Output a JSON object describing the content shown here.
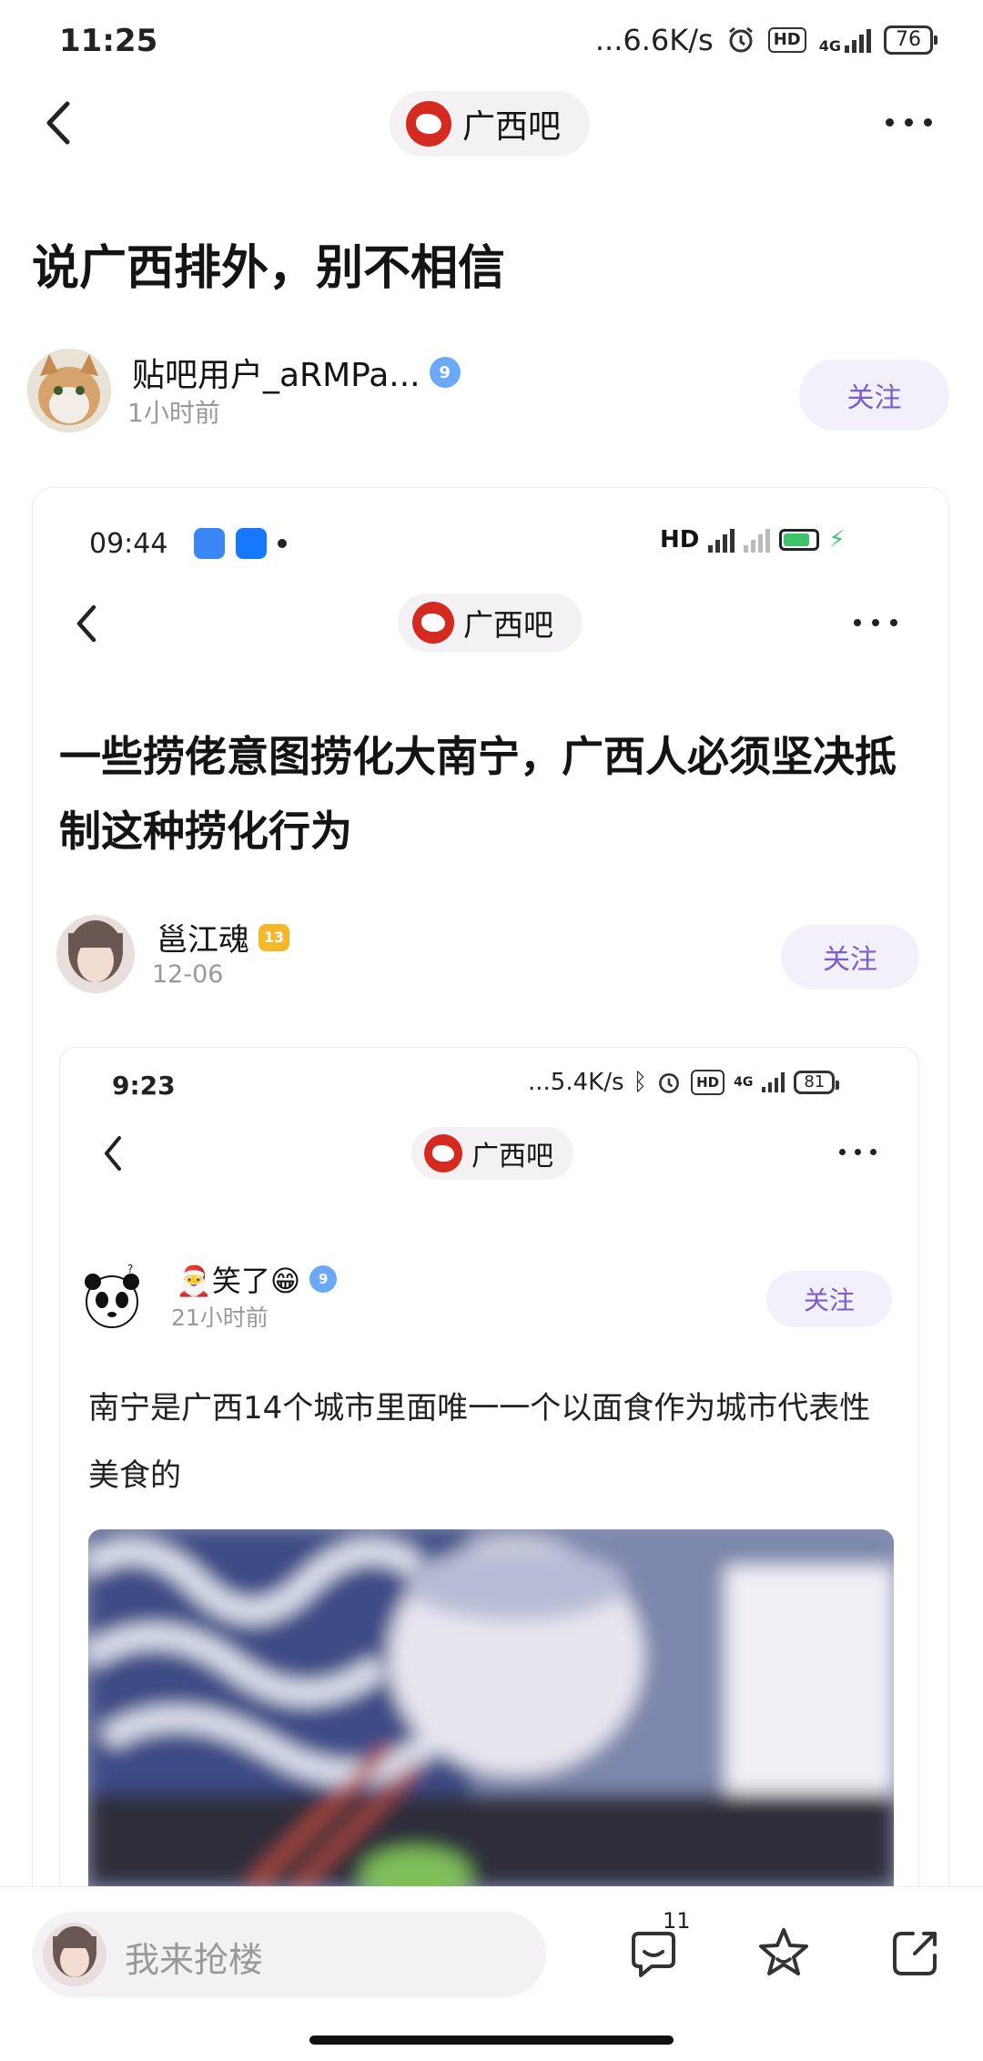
{
  "status_bar": {
    "time": "11:25",
    "speed": "...6.6K/s",
    "hd": "HD",
    "network": "4G",
    "battery": "76"
  },
  "header": {
    "forum_name": "广西吧"
  },
  "post": {
    "title": "说广西排外，别不相信",
    "author": "贴吧用户_aRMPa...",
    "author_level": "9",
    "time": "1小时前",
    "follow_label": "关注"
  },
  "screenshot1": {
    "status_time": "09:44",
    "status_right": "HD",
    "forum_name": "广西吧",
    "title": "一些捞佬意图捞化大南宁，广西人必须坚决抵制这种捞化行为",
    "author": "邕江魂",
    "author_level": "13",
    "time": "12-06",
    "follow_label": "关注"
  },
  "screenshot2": {
    "status_time": "9:23",
    "speed": "...5.4K/s",
    "hd": "HD",
    "network": "4G",
    "battery": "81",
    "forum_name": "广西吧",
    "author": "🎅笑了😁",
    "author_level": "9",
    "time": "21小时前",
    "follow_label": "关注",
    "body": "南宁是广西14个城市里面唯一一个以面食作为城市代表性美食的"
  },
  "bottom_bar": {
    "comment_placeholder": "我来抢楼",
    "comment_count": "11"
  }
}
